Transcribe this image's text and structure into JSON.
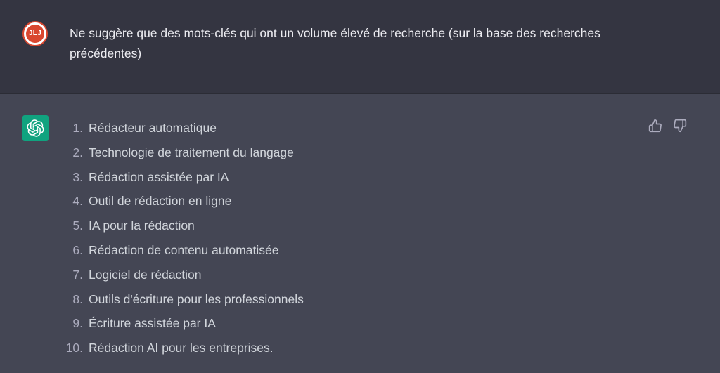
{
  "user": {
    "avatar_initials": "JLJ",
    "message": "Ne suggère que des mots-clés qui ont un volume élevé de recherche (sur la base des recherches précédentes)"
  },
  "assistant": {
    "avatar_icon": "openai-logo-icon",
    "items": [
      {
        "num": "1.",
        "text": "Rédacteur automatique"
      },
      {
        "num": "2.",
        "text": "Technologie de traitement du langage"
      },
      {
        "num": "3.",
        "text": "Rédaction assistée par IA"
      },
      {
        "num": "4.",
        "text": "Outil de rédaction en ligne"
      },
      {
        "num": "5.",
        "text": "IA pour la rédaction"
      },
      {
        "num": "6.",
        "text": "Rédaction de contenu automatisée"
      },
      {
        "num": "7.",
        "text": "Logiciel de rédaction"
      },
      {
        "num": "8.",
        "text": "Outils d'écriture pour les professionnels"
      },
      {
        "num": "9.",
        "text": "Écriture assistée par IA"
      },
      {
        "num": "10.",
        "text": "Rédaction AI pour les entreprises."
      }
    ],
    "feedback_icons": [
      "thumbs-up-icon",
      "thumbs-down-icon"
    ]
  },
  "colors": {
    "user_row_bg": "#343541",
    "assistant_row_bg": "#444654",
    "bot_avatar_bg": "#10a37f",
    "user_avatar_accent": "#d9472f"
  }
}
